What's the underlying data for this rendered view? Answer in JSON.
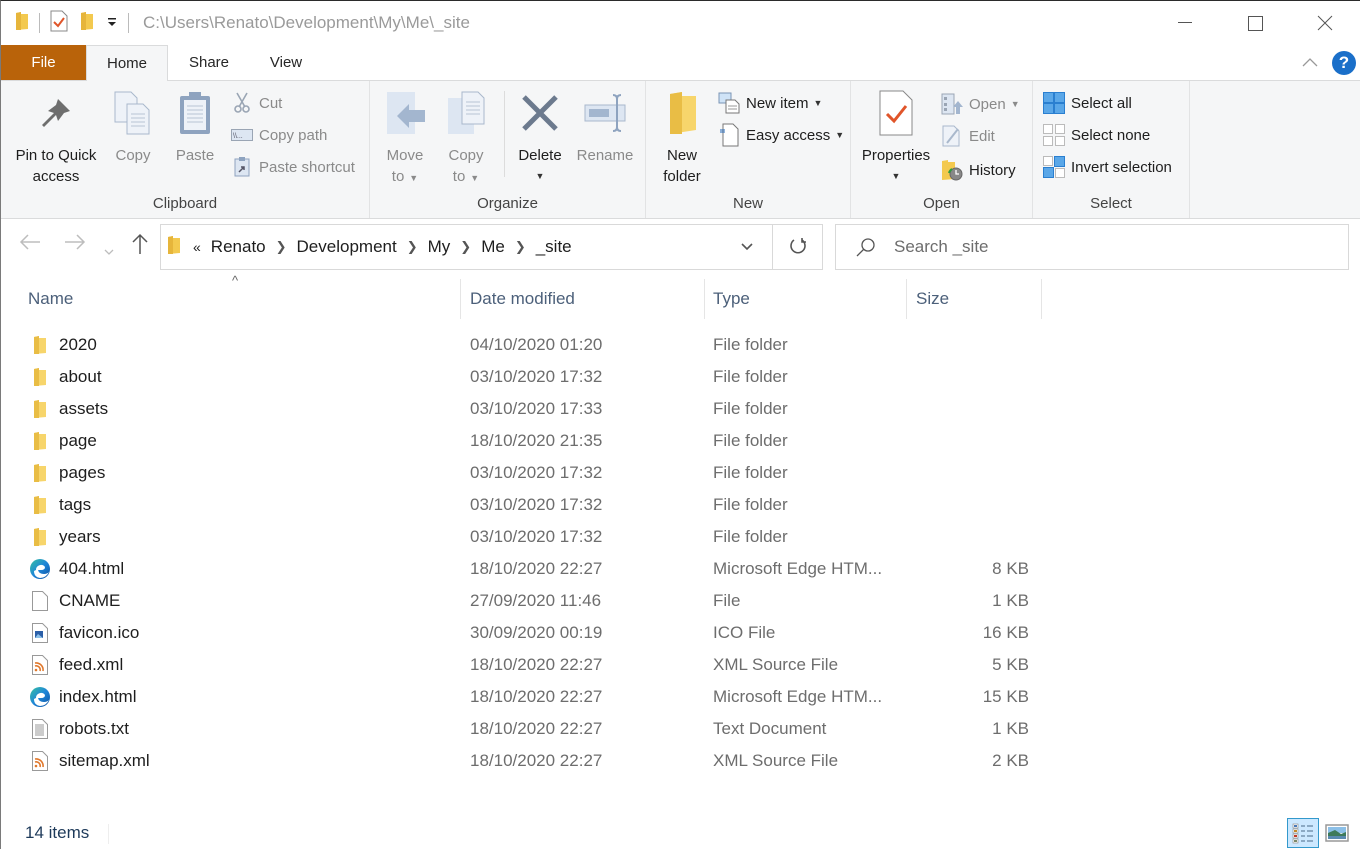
{
  "window": {
    "title_path": "C:\\Users\\Renato\\Development\\My\\Me\\_site",
    "controls": {
      "minimize": "minimize",
      "maximize": "maximize",
      "close": "close"
    }
  },
  "quick_access_toolbar": {
    "icons": [
      "folder-icon",
      "properties-icon",
      "new-folder-icon",
      "customize-dropdown-icon"
    ]
  },
  "tabs": [
    {
      "label": "File",
      "active": false
    },
    {
      "label": "Home",
      "active": true
    },
    {
      "label": "Share",
      "active": false
    },
    {
      "label": "View",
      "active": false
    }
  ],
  "ribbon": {
    "clipboard": {
      "label": "Clipboard",
      "pin_line1": "Pin to Quick",
      "pin_line2": "access",
      "copy": "Copy",
      "paste": "Paste",
      "cut": "Cut",
      "copy_path": "Copy path",
      "paste_shortcut": "Paste shortcut"
    },
    "organize": {
      "label": "Organize",
      "move_line1": "Move",
      "move_line2": "to",
      "copy_line1": "Copy",
      "copy_line2": "to",
      "delete": "Delete",
      "rename": "Rename"
    },
    "new": {
      "label": "New",
      "new_folder_line1": "New",
      "new_folder_line2": "folder",
      "new_item": "New item",
      "easy_access": "Easy access"
    },
    "open": {
      "label": "Open",
      "properties": "Properties",
      "open": "Open",
      "edit": "Edit",
      "history": "History"
    },
    "select": {
      "label": "Select",
      "select_all": "Select all",
      "select_none": "Select none",
      "invert_selection": "Invert selection"
    }
  },
  "navigation": {
    "overflow": "«",
    "breadcrumbs": [
      "Renato",
      "Development",
      "My",
      "Me",
      "_site"
    ],
    "search_placeholder": "Search _site"
  },
  "columns": {
    "name": "Name",
    "date_modified": "Date modified",
    "type": "Type",
    "size": "Size",
    "sort_indicator": "^"
  },
  "files": [
    {
      "name": "2020",
      "date": "04/10/2020 01:20",
      "type": "File folder",
      "size": "",
      "icon": "folder"
    },
    {
      "name": "about",
      "date": "03/10/2020 17:32",
      "type": "File folder",
      "size": "",
      "icon": "folder"
    },
    {
      "name": "assets",
      "date": "03/10/2020 17:33",
      "type": "File folder",
      "size": "",
      "icon": "folder"
    },
    {
      "name": "page",
      "date": "18/10/2020 21:35",
      "type": "File folder",
      "size": "",
      "icon": "folder"
    },
    {
      "name": "pages",
      "date": "03/10/2020 17:32",
      "type": "File folder",
      "size": "",
      "icon": "folder"
    },
    {
      "name": "tags",
      "date": "03/10/2020 17:32",
      "type": "File folder",
      "size": "",
      "icon": "folder"
    },
    {
      "name": "years",
      "date": "03/10/2020 17:32",
      "type": "File folder",
      "size": "",
      "icon": "folder"
    },
    {
      "name": "404.html",
      "date": "18/10/2020 22:27",
      "type": "Microsoft Edge HTM...",
      "size": "8 KB",
      "icon": "edge"
    },
    {
      "name": "CNAME",
      "date": "27/09/2020 11:46",
      "type": "File",
      "size": "1 KB",
      "icon": "blank"
    },
    {
      "name": "favicon.ico",
      "date": "30/09/2020 00:19",
      "type": "ICO File",
      "size": "16 KB",
      "icon": "image"
    },
    {
      "name": "feed.xml",
      "date": "18/10/2020 22:27",
      "type": "XML Source File",
      "size": "5 KB",
      "icon": "rss"
    },
    {
      "name": "index.html",
      "date": "18/10/2020 22:27",
      "type": "Microsoft Edge HTM...",
      "size": "15 KB",
      "icon": "edge"
    },
    {
      "name": "robots.txt",
      "date": "18/10/2020 22:27",
      "type": "Text Document",
      "size": "1 KB",
      "icon": "text"
    },
    {
      "name": "sitemap.xml",
      "date": "18/10/2020 22:27",
      "type": "XML Source File",
      "size": "2 KB",
      "icon": "rss"
    }
  ],
  "status": {
    "item_count": "14 items"
  },
  "colors": {
    "file_tab": "#b9630a",
    "help": "#1a6fc9",
    "folder": "#f3c94f",
    "edge": "#1f86d8",
    "rss": "#e0782c",
    "view_active": "#cce8ff"
  }
}
